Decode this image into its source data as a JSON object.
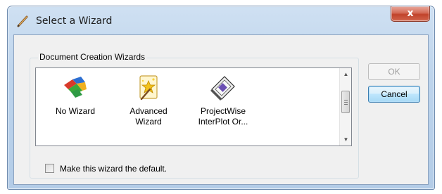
{
  "window": {
    "title": "Select a Wizard",
    "close_label": "x",
    "icon": "pencil-icon"
  },
  "group": {
    "label": "Document Creation Wizards"
  },
  "wizards": [
    {
      "label_line1": "No Wizard",
      "label_line2": "",
      "icon": "no-wizard-icon"
    },
    {
      "label_line1": "Advanced",
      "label_line2": "Wizard",
      "icon": "advanced-wizard-icon"
    },
    {
      "label_line1": "ProjectWise",
      "label_line2": "InterPlot Or...",
      "icon": "interplot-icon"
    }
  ],
  "buttons": {
    "ok": "OK",
    "cancel": "Cancel"
  },
  "default_checkbox": {
    "label": "Make this wizard the default.",
    "checked": false
  },
  "colors": {
    "close_button": "#c1432b",
    "frame": "#bdd4ec",
    "selection_focus": "#3c7fb1"
  }
}
